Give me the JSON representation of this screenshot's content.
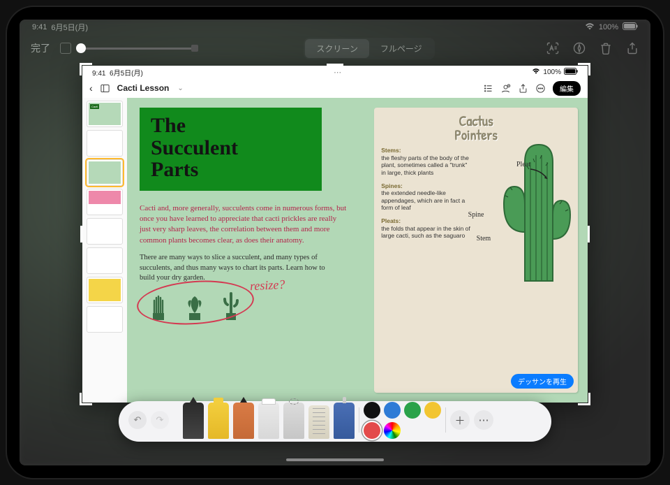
{
  "outer_status": {
    "time": "9:41",
    "date": "6月5日(月)",
    "battery": "100%"
  },
  "outer_toolbar": {
    "done": "完了",
    "seg_screen": "スクリーン",
    "seg_fullpage": "フルページ"
  },
  "inner_status": {
    "time": "9:41",
    "date": "6月5日(月)",
    "battery": "100%"
  },
  "inner_toolbar": {
    "doc_title": "Cacti Lesson",
    "edit": "編集"
  },
  "thumb_labels": {
    "cacti": "Cacti"
  },
  "page": {
    "title_l1": "The",
    "title_l2": "Succulent",
    "title_l3": "Parts",
    "intro": "Cacti and, more generally, succulents come in numerous forms, but once you have learned to appreciate that cacti prickles are really just very sharp leaves, the correlation between them and more common plants becomes clear, as does their anatomy.",
    "para2": "There are many ways to slice a succulent, and many types of succulents, and thus many ways to chart its parts. Learn how to build your dry garden.",
    "annotation": "resize?"
  },
  "card": {
    "title_l1": "Cactus",
    "title_l2": "Pointers",
    "stems_h": "Stems:",
    "stems": "the fleshy parts of the body of the plant, sometimes called a \"trunk\" in large, thick plants",
    "spines_h": "Spines:",
    "spines": "the extended needle-like appendages, which are in fact a form of leaf",
    "pleats_h": "Pleats:",
    "pleats": "the folds that appear in the skin of large cacti, such as the saguaro",
    "anno_pleat": "Pleat",
    "anno_spine": "Spine",
    "anno_stem": "Stem",
    "replay": "デッサンを再生"
  },
  "palette": {
    "colors": [
      "#111111",
      "#2e7bd6",
      "#2aa24a",
      "#f2c531",
      "#e34b4b"
    ]
  }
}
